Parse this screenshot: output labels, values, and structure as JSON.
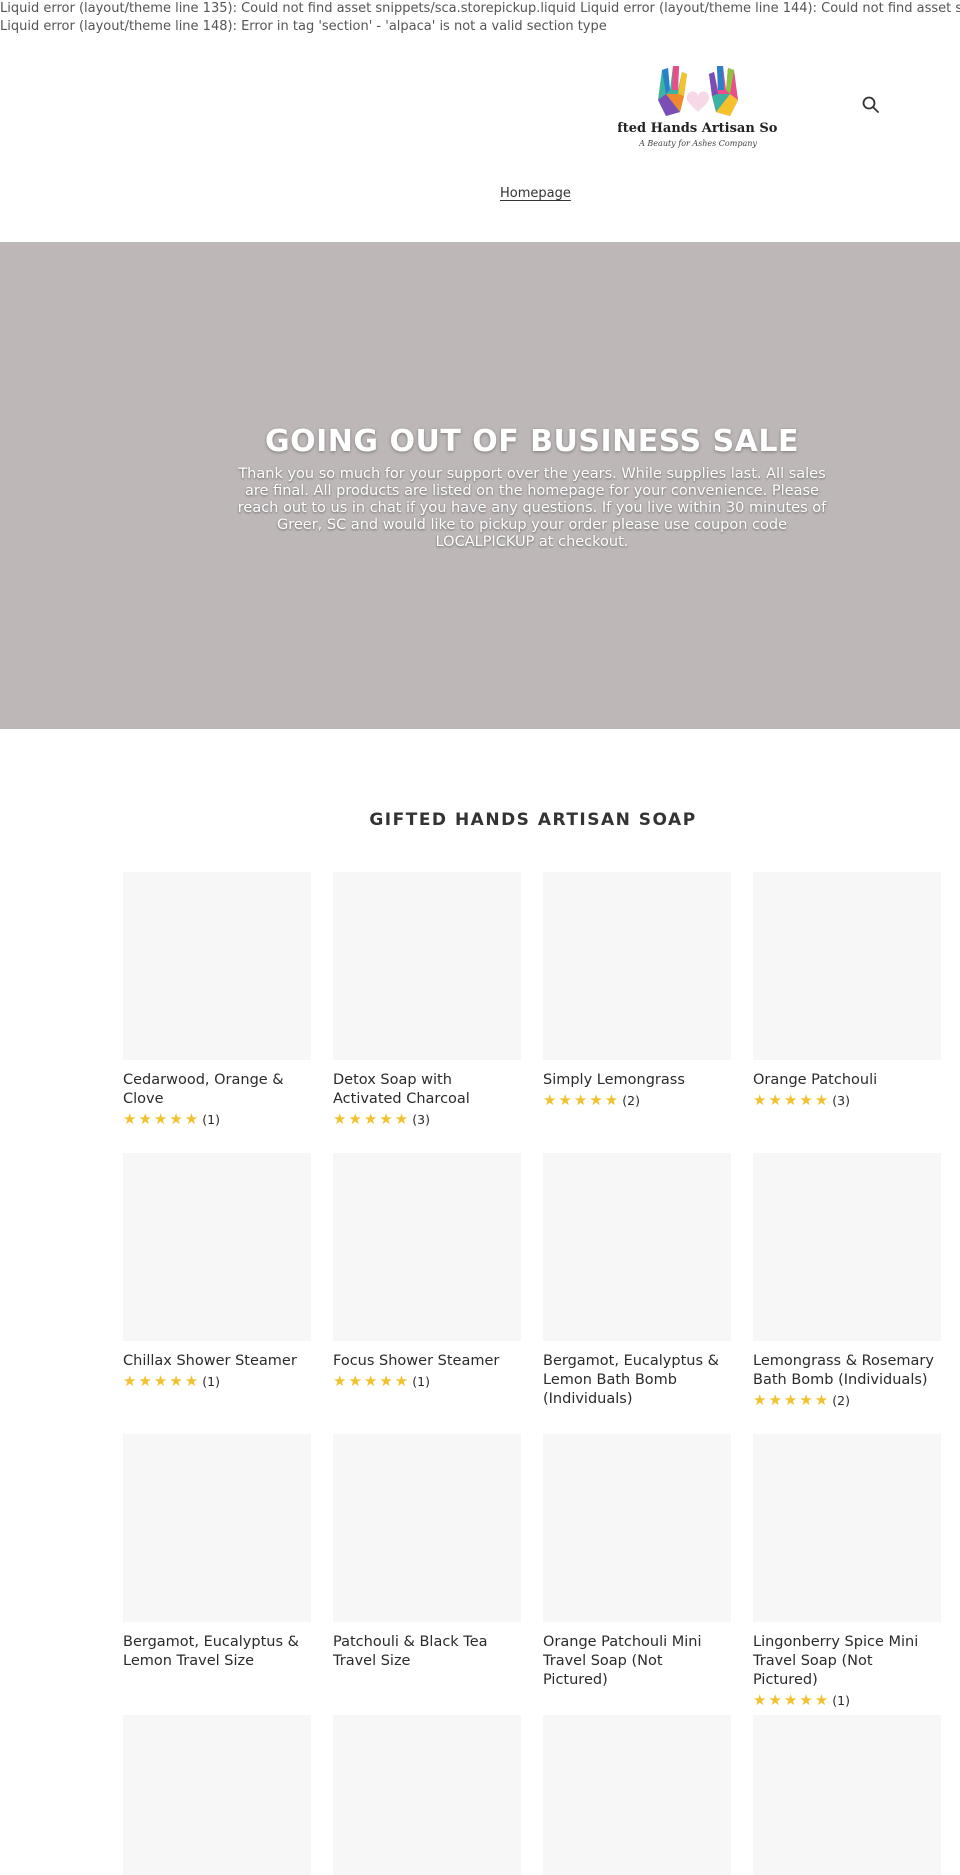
{
  "errors": [
    "Liquid error (layout/theme line 135): Could not find asset snippets/sca.storepickup.liquid Liquid error (layout/theme line 144): Could not find asset snippets/genie-stor",
    "Liquid error (layout/theme line 148): Error in tag 'section' - 'alpaca' is not a valid section type"
  ],
  "header": {
    "logo_title": "Gifted Hands Artisan Soap",
    "logo_tagline": "A Beauty for Ashes Company",
    "search_icon": "search-icon",
    "nav": {
      "homepage": "Homepage"
    }
  },
  "hero": {
    "title": "GOING OUT OF BUSINESS SALE",
    "text": "Thank you so much for your support over the years. While supplies last. All sales are final. All products are listed on the homepage for your convenience. Please reach out to us in chat if you have any questions. If you live within 30 minutes of Greer, SC and would like to pickup your order please use coupon code LOCALPICKUP at checkout.",
    "background": "#bdb7b7"
  },
  "collection": {
    "title": "GIFTED HANDS ARTISAN SOAP",
    "star_color": "#f2c12e",
    "products": [
      {
        "name": "Cedarwood, Orange & Clove",
        "stars": "★★★★★",
        "count": "(1)"
      },
      {
        "name": "Detox Soap with Activated Charcoal",
        "stars": "★★★★★",
        "count": "(3)"
      },
      {
        "name": "Simply Lemongrass",
        "stars": "★★★★★",
        "count": "(2)"
      },
      {
        "name": "Orange Patchouli",
        "stars": "★★★★★",
        "count": "(3)"
      },
      {
        "name": "Chillax Shower Steamer",
        "stars": "★★★★★",
        "count": "(1)"
      },
      {
        "name": "Focus Shower Steamer",
        "stars": "★★★★★",
        "count": "(1)"
      },
      {
        "name": "Bergamot, Eucalyptus & Lemon Bath Bomb (Individuals)",
        "stars": "",
        "count": ""
      },
      {
        "name": "Lemongrass & Rosemary Bath Bomb (Individuals)",
        "stars": "★★★★★",
        "count": "(2)"
      },
      {
        "name": "Bergamot, Eucalyptus & Lemon Travel Size",
        "stars": "",
        "count": ""
      },
      {
        "name": "Patchouli & Black Tea Travel Size",
        "stars": "",
        "count": ""
      },
      {
        "name": "Orange Patchouli Mini Travel Soap (Not Pictured)",
        "stars": "",
        "count": ""
      },
      {
        "name": "Lingonberry Spice Mini Travel Soap (Not Pictured)",
        "stars": "★★★★★",
        "count": "(1)"
      },
      {
        "name": "",
        "stars": "",
        "count": ""
      },
      {
        "name": "",
        "stars": "",
        "count": ""
      },
      {
        "name": "",
        "stars": "",
        "count": ""
      },
      {
        "name": "",
        "stars": "",
        "count": ""
      }
    ]
  }
}
